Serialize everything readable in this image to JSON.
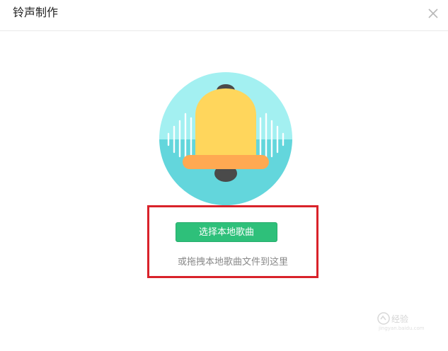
{
  "dialog": {
    "title": "铃声制作",
    "close_icon": "close-icon"
  },
  "illustration": {
    "icon": "bell-icon",
    "circle_top_color": "#a3f0f1",
    "circle_bottom_color": "#63d6dc",
    "bell_color": "#ffd65c",
    "bell_rim_color": "#ffa952",
    "clapper_color": "#4a4a4a"
  },
  "upload": {
    "select_button_label": "选择本地歌曲",
    "drag_hint": "或拖拽本地歌曲文件到这里",
    "button_color": "#2ec07a",
    "highlight_color": "#d9222a"
  },
  "watermark": {
    "text": "经验",
    "sub_text": "jingyan.baidu.com"
  }
}
